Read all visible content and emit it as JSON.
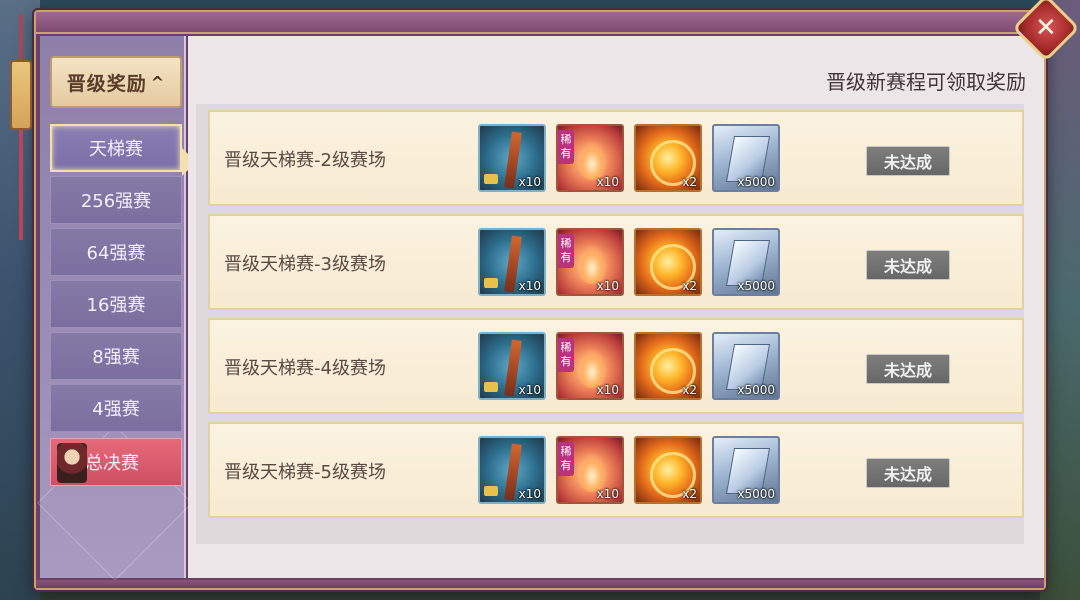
{
  "sidebar": {
    "header_label": "晋级奖励",
    "items": [
      {
        "label": "天梯赛"
      },
      {
        "label": "256强赛"
      },
      {
        "label": "64强赛"
      },
      {
        "label": "16强赛"
      },
      {
        "label": "8强赛"
      },
      {
        "label": "4强赛"
      },
      {
        "label": "总决赛"
      }
    ]
  },
  "main": {
    "title": "晋级新赛程可领取奖励",
    "rare_tag": "稀有",
    "rows": [
      {
        "label": "晋级天梯赛-2级赛场",
        "items": [
          "x10",
          "x10",
          "x2",
          "x5000"
        ],
        "status": "未达成"
      },
      {
        "label": "晋级天梯赛-3级赛场",
        "items": [
          "x10",
          "x10",
          "x2",
          "x5000"
        ],
        "status": "未达成"
      },
      {
        "label": "晋级天梯赛-4级赛场",
        "items": [
          "x10",
          "x10",
          "x2",
          "x5000"
        ],
        "status": "未达成"
      },
      {
        "label": "晋级天梯赛-5级赛场",
        "items": [
          "x10",
          "x10",
          "x2",
          "x5000"
        ],
        "status": "未达成"
      }
    ]
  }
}
